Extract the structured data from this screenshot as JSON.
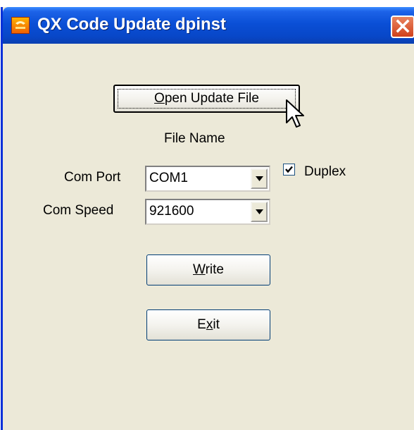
{
  "window": {
    "title": "QX Code Update dpinst"
  },
  "buttons": {
    "open_update_file": {
      "pre": "",
      "accel": "O",
      "post": "pen Update File"
    },
    "write": {
      "pre": "",
      "accel": "W",
      "post": "rite"
    },
    "exit": {
      "pre": "E",
      "accel": "x",
      "post": "it"
    }
  },
  "file_name_label": "File Name",
  "com_port": {
    "label": "Com Port",
    "value": "COM1"
  },
  "com_speed": {
    "label": "Com Speed",
    "value": "921600"
  },
  "duplex": {
    "label": "Duplex",
    "checked": true
  }
}
